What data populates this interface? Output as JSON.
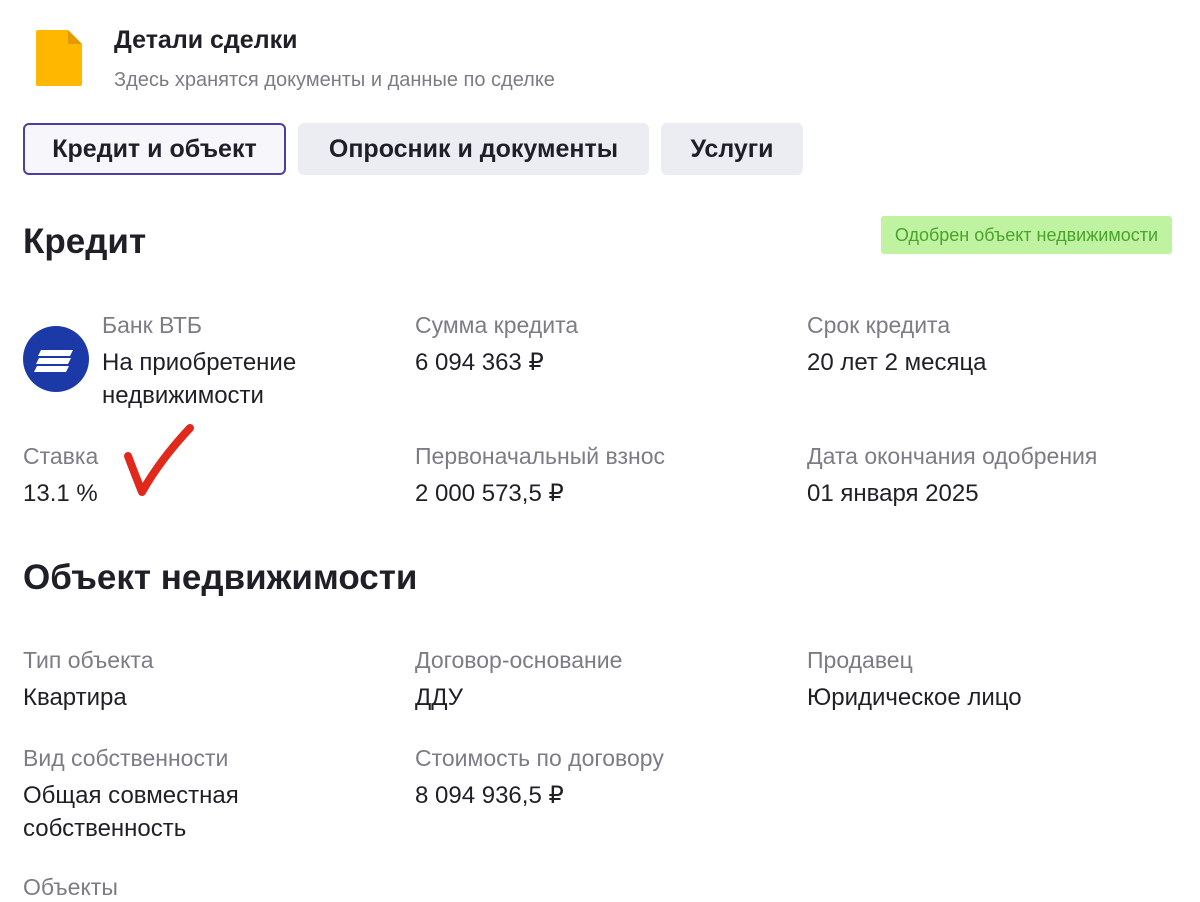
{
  "header": {
    "title": "Детали сделки",
    "subtitle": "Здесь хранятся документы и данные по сделке",
    "icon": "document-icon"
  },
  "tabs": [
    {
      "label": "Кредит и объект",
      "active": true
    },
    {
      "label": "Опросник и документы",
      "active": false
    },
    {
      "label": "Услуги",
      "active": false
    }
  ],
  "credit": {
    "title": "Кредит",
    "status_badge": "Одобрен объект недвижимости",
    "bank": {
      "label": "Банк ВТБ",
      "value": "На приобретение недвижимости",
      "logo": "vtb-logo-icon"
    },
    "amount": {
      "label": "Сумма кредита",
      "value": "6 094 363 ₽"
    },
    "term": {
      "label": "Срок кредита",
      "value": "20 лет 2 месяца"
    },
    "rate": {
      "label": "Ставка",
      "value": "13.1 %"
    },
    "down_payment": {
      "label": "Первоначальный взнос",
      "value": "2 000 573,5 ₽"
    },
    "approval_end": {
      "label": "Дата окончания одобрения",
      "value": "01 января 2025"
    }
  },
  "property": {
    "title": "Объект недвижимости",
    "type": {
      "label": "Тип объекта",
      "value": "Квартира"
    },
    "contract_basis": {
      "label": "Договор-основание",
      "value": "ДДУ"
    },
    "seller": {
      "label": "Продавец",
      "value": "Юридическое лицо"
    },
    "ownership": {
      "label": "Вид собственности",
      "value": "Общая совместная собственность"
    },
    "contract_price": {
      "label": "Стоимость по договору",
      "value": "8 094 936,5 ₽"
    },
    "objects": {
      "label": "Объекты"
    }
  },
  "colors": {
    "tab_active_border": "#4d3ea3",
    "badge_bg": "#bff3a2",
    "badge_text": "#4aa32a",
    "bank_logo": "#1b3aa8",
    "doc_icon": "#ffb700",
    "checkmark": "#e0281b"
  }
}
